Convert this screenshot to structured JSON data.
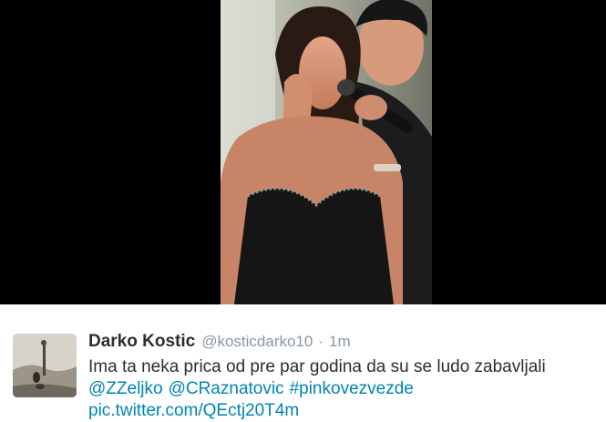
{
  "colors": {
    "background_media": "#000000",
    "text_primary": "#292f33",
    "text_secondary": "#8899a6",
    "link": "#0084b4"
  },
  "media": {
    "icon": "photo-of-two-people-singing"
  },
  "tweet": {
    "author": {
      "display_name": "Darko Kostic",
      "handle": "@kosticdarko10",
      "avatar_icon": "avatar-photo"
    },
    "separator": "·",
    "timestamp": "1m",
    "text_line_1": "Ima ta neka prica od pre par godina da su se ludo zabavljali",
    "mentions": [
      "@ZZeljko",
      "@CRaznatovic"
    ],
    "hashtag": "#pinkovezvezde",
    "pic_link": "pic.twitter.com/QEctj20T4m"
  }
}
